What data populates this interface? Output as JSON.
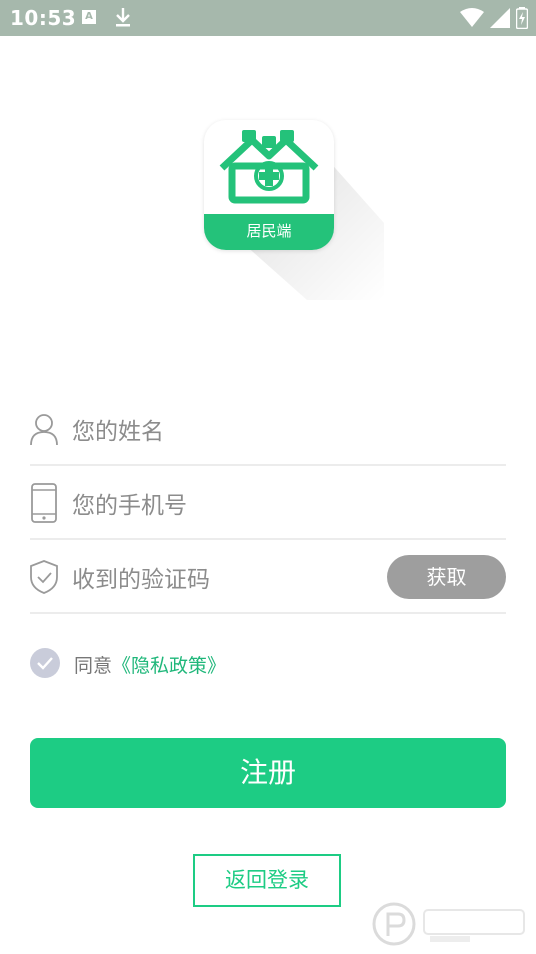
{
  "status_bar": {
    "time": "10:53",
    "notification_letter": "A",
    "icons": [
      "a-notification-icon",
      "download-icon",
      "wifi-icon",
      "signal-icon",
      "battery-icon"
    ]
  },
  "logo": {
    "caption": "居民端",
    "brand_color": "#24c27a"
  },
  "form": {
    "name_placeholder": "您的姓名",
    "phone_placeholder": "您的手机号",
    "code_placeholder": "收到的验证码",
    "get_code_label": "获取"
  },
  "agreement": {
    "prefix": "同意",
    "link": "《隐私政策》",
    "checked": true
  },
  "actions": {
    "register_label": "注册",
    "back_login_label": "返回登录"
  },
  "colors": {
    "accent": "#1dcc84",
    "status_bar": "#a6b8ac",
    "disabled_button": "#9e9e9e"
  }
}
